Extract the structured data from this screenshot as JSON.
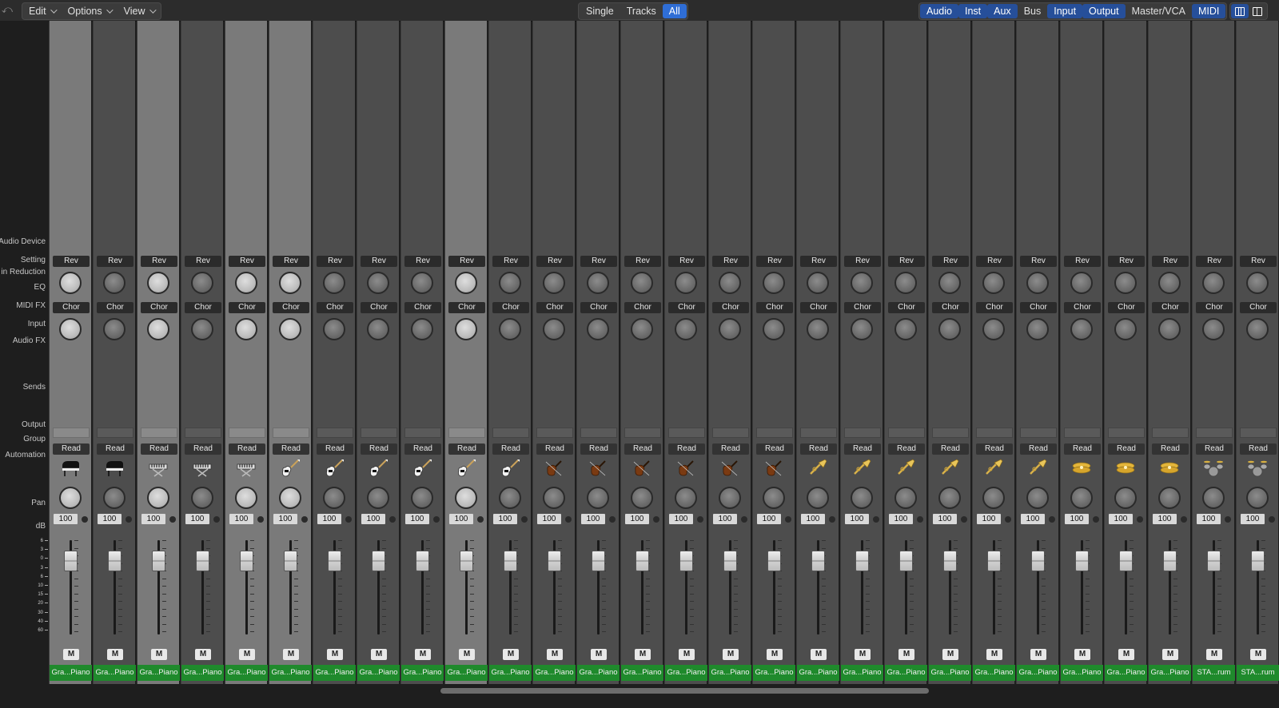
{
  "toolbar": {
    "menus": [
      {
        "label": "Edit"
      },
      {
        "label": "Options"
      },
      {
        "label": "View"
      }
    ],
    "scope": [
      {
        "label": "Single",
        "active": false
      },
      {
        "label": "Tracks",
        "active": false
      },
      {
        "label": "All",
        "active": true
      }
    ],
    "filters": [
      {
        "label": "Audio",
        "active": true
      },
      {
        "label": "Inst",
        "active": true
      },
      {
        "label": "Aux",
        "active": true
      },
      {
        "label": "Bus",
        "active": false
      },
      {
        "label": "Input",
        "active": true
      },
      {
        "label": "Output",
        "active": true
      },
      {
        "label": "Master/VCA",
        "active": false
      },
      {
        "label": "MIDI",
        "active": true
      }
    ],
    "view_buttons": [
      {
        "icon": "three-column-view-icon",
        "active": true
      },
      {
        "icon": "two-column-view-icon",
        "active": false
      }
    ]
  },
  "row_labels": {
    "audio_device": "Audio Device",
    "setting": "Setting",
    "gain_reduction": "in Reduction",
    "eq": "EQ",
    "midi_fx": "MIDI FX",
    "input": "Input",
    "audio_fx": "Audio FX",
    "sends": "Sends",
    "output": "Output",
    "group": "Group",
    "automation": "Automation",
    "pan": "Pan",
    "db": "dB"
  },
  "db_scale": [
    "6",
    "3",
    "0",
    "3",
    "6",
    "10",
    "15",
    "20",
    "30",
    "40",
    "60"
  ],
  "strip_defaults": {
    "setting_label": "Rev",
    "midi_fx_label": "Chor",
    "automation_label": "Read",
    "db_value": "100",
    "mute_label": "M"
  },
  "strips": [
    {
      "name": "Gra...Piano",
      "icon": "grand-piano-icon",
      "selected": true
    },
    {
      "name": "Gra...Piano",
      "icon": "grand-piano-icon",
      "selected": false
    },
    {
      "name": "Gra...Piano",
      "icon": "keyboard-icon",
      "selected": true
    },
    {
      "name": "Gra...Piano",
      "icon": "keyboard-icon",
      "selected": false
    },
    {
      "name": "Gra...Piano",
      "icon": "keyboard-icon",
      "selected": true
    },
    {
      "name": "Gra...Piano",
      "icon": "electric-guitar-icon",
      "selected": true
    },
    {
      "name": "Gra...Piano",
      "icon": "electric-guitar-icon",
      "selected": false
    },
    {
      "name": "Gra...Piano",
      "icon": "electric-guitar-icon",
      "selected": false
    },
    {
      "name": "Gra...Piano",
      "icon": "electric-guitar-icon",
      "selected": false
    },
    {
      "name": "Gra...Piano",
      "icon": "electric-guitar-icon",
      "selected": true
    },
    {
      "name": "Gra...Piano",
      "icon": "electric-guitar-icon",
      "selected": false
    },
    {
      "name": "Gra...Piano",
      "icon": "violin-icon",
      "selected": false
    },
    {
      "name": "Gra...Piano",
      "icon": "violin-icon",
      "selected": false
    },
    {
      "name": "Gra...Piano",
      "icon": "violin-icon",
      "selected": false
    },
    {
      "name": "Gra...Piano",
      "icon": "violin-icon",
      "selected": false
    },
    {
      "name": "Gra...Piano",
      "icon": "violin-icon",
      "selected": false
    },
    {
      "name": "Gra...Piano",
      "icon": "violin-icon",
      "selected": false
    },
    {
      "name": "Gra...Piano",
      "icon": "trumpet-icon",
      "selected": false
    },
    {
      "name": "Gra...Piano",
      "icon": "trumpet-icon",
      "selected": false
    },
    {
      "name": "Gra...Piano",
      "icon": "trumpet-icon",
      "selected": false
    },
    {
      "name": "Gra...Piano",
      "icon": "trumpet-icon",
      "selected": false
    },
    {
      "name": "Gra...Piano",
      "icon": "trumpet-icon",
      "selected": false
    },
    {
      "name": "Gra...Piano",
      "icon": "trumpet-icon",
      "selected": false
    },
    {
      "name": "Gra...Piano",
      "icon": "cymbal-icon",
      "selected": false
    },
    {
      "name": "Gra...Piano",
      "icon": "cymbal-icon",
      "selected": false
    },
    {
      "name": "Gra...Piano",
      "icon": "cymbal-icon",
      "selected": false
    },
    {
      "name": "STA...rum",
      "icon": "drum-kit-icon",
      "selected": false
    },
    {
      "name": "STA...rum",
      "icon": "drum-kit-icon",
      "selected": false
    }
  ],
  "colors": {
    "accent_blue": "#2f6ed6",
    "track_green": "#1f8a2c",
    "strip_gray": "#4d4d4d",
    "strip_selected": "#7a7a7a"
  }
}
